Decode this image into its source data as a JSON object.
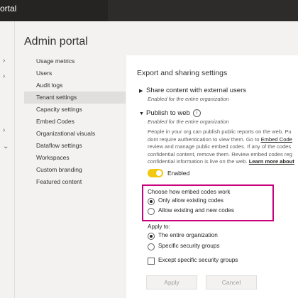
{
  "window": {
    "title": "ortal"
  },
  "page": {
    "title": "Admin portal"
  },
  "subnav": {
    "items": [
      {
        "label": "Usage metrics"
      },
      {
        "label": "Users"
      },
      {
        "label": "Audit logs"
      },
      {
        "label": "Tenant settings",
        "active": true
      },
      {
        "label": "Capacity settings"
      },
      {
        "label": "Embed Codes"
      },
      {
        "label": "Organizational visuals"
      },
      {
        "label": "Dataflow settings"
      },
      {
        "label": "Workspaces"
      },
      {
        "label": "Custom branding"
      },
      {
        "label": "Featured content"
      }
    ]
  },
  "settings": {
    "section_title": "Export and sharing settings",
    "share_external": {
      "title": "Share content with external users",
      "subtitle": "Enabled for the entire organization"
    },
    "publish": {
      "title": "Publish to web",
      "subtitle": "Enabled for the entire organization",
      "desc_1": "People in your org can publish public reports on the web. Pu",
      "desc_2a": "dont require authentication to view them. Go to ",
      "desc_2b": "Embed Code",
      "desc_3": "review and manage public embed codes. If any of the codes",
      "desc_4": "confidential content, remove them. Review embed codes reg",
      "desc_5a": "confidential information is live on the web. ",
      "desc_5b": "Learn more about",
      "toggle_label": "Enabled",
      "toggle_on": true
    },
    "embed_codes": {
      "label": "Choose how embed codes work",
      "options": [
        {
          "label": "Only allow existing codes",
          "selected": true
        },
        {
          "label": "Allow existing and new codes",
          "selected": false
        }
      ]
    },
    "apply_to": {
      "label": "Apply to:",
      "options": [
        {
          "label": "The entire organization",
          "selected": true
        },
        {
          "label": "Specific security groups",
          "selected": false
        }
      ]
    },
    "except_groups": {
      "label": "Except specific security groups",
      "checked": false
    },
    "buttons": {
      "apply": "Apply",
      "cancel": "Cancel"
    }
  },
  "colors": {
    "accent": "#f2c811",
    "highlight": "#c8007d",
    "topbar": "#252423"
  }
}
